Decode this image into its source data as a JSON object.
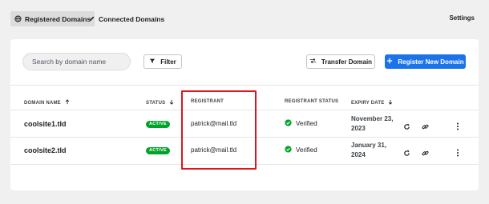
{
  "tabs": [
    {
      "label": "Registered Domains",
      "icon": "globe-icon",
      "active": true
    },
    {
      "label": "Connected Domains",
      "icon": "pencil-icon",
      "active": false
    }
  ],
  "settings_label": "Settings",
  "toolbar": {
    "search_placeholder": "Search by domain name",
    "filter_label": "Filter",
    "transfer_label": "Transfer Domain",
    "register_label": "Register New Domain"
  },
  "table": {
    "headers": {
      "domain": "DOMAIN NAME",
      "status": "STATUS",
      "registrant": "REGISTRANT",
      "registrant_status": "REGISTRANT STATUS",
      "expiry": "EXPIRY DATE"
    },
    "rows": [
      {
        "domain": "coolsite1.tld",
        "status": "ACTIVE",
        "registrant": "patrick@mail.tld",
        "registrant_status": "Verified",
        "expiry_line1": "November 23,",
        "expiry_line2": "2023"
      },
      {
        "domain": "coolsite2.tld",
        "status": "ACTIVE",
        "registrant": "patrick@mail.tld",
        "registrant_status": "Verified",
        "expiry_line1": "January 31,",
        "expiry_line2": "2024"
      }
    ]
  },
  "colors": {
    "accent": "#1a73e8",
    "active_badge": "#00a32a",
    "verified": "#00a32a",
    "highlight": "#e0141e"
  }
}
